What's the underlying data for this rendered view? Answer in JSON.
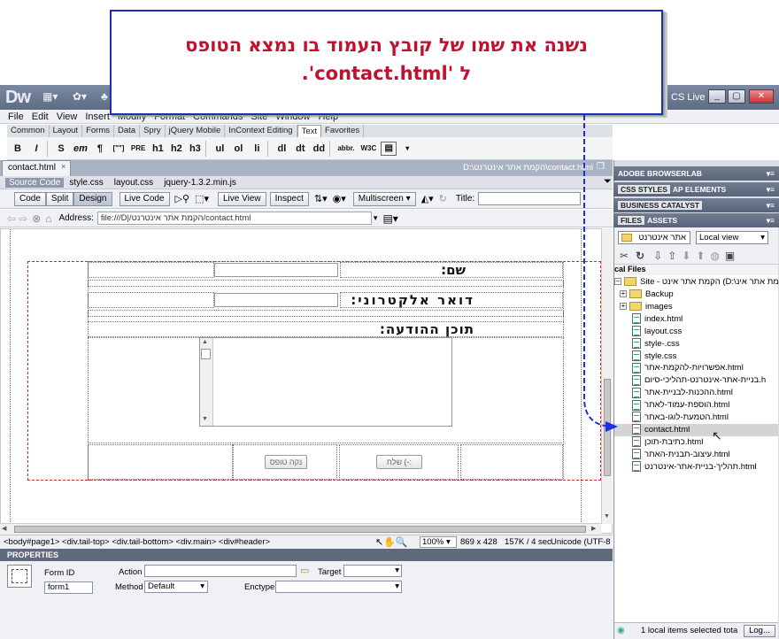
{
  "app": {
    "logo": "Dw",
    "cs_live": "CS Live",
    "window_buttons": [
      "_",
      "▢",
      "✕"
    ]
  },
  "menu": [
    "File",
    "Edit",
    "View",
    "Insert",
    "Modify",
    "Format",
    "Commands",
    "Site",
    "Window",
    "Help"
  ],
  "insert_tabs": [
    "Common",
    "Layout",
    "Forms",
    "Data",
    "Spry",
    "jQuery Mobile",
    "InContext Editing",
    "Text",
    "Favorites"
  ],
  "active_insert_tab": "Text",
  "text_tools": [
    "B",
    "I",
    "S",
    "em",
    "¶",
    "[\"\"]",
    "PRE",
    "h1",
    "h2",
    "h3",
    "ul",
    "ol",
    "li",
    "dl",
    "dt",
    "dd",
    "abbr.",
    "W3C"
  ],
  "document": {
    "tab_name": "contact.html",
    "path": "D:\\הקמת אתר אינטרנט\\contact.html",
    "source_code": "Source Code",
    "related_files": [
      "style.css",
      "layout.css",
      "jquery-1.3.2.min.js"
    ],
    "view_buttons": [
      "Code",
      "Split",
      "Design"
    ],
    "live_code": "Live Code",
    "live_view": "Live View",
    "inspect": "Inspect",
    "multiscreen": "Multiscreen",
    "title_label": "Title:",
    "address_label": "Address:",
    "address_value": "file:///D|/הקמת אתר אינטרנט/contact.html"
  },
  "form": {
    "name_label": "שם:",
    "email_label": "דואר אלקטרוני:",
    "message_label": "תוכן ההודעה:",
    "send_button": "שלח (-:",
    "clear_button": "נקה טופס"
  },
  "status_bar": {
    "tag_path": "<body#page1> <div.tail-top> <div.tail-bottom> <div.main> <div#header>",
    "zoom": "100%",
    "dimensions": "869 x 428",
    "size_time": "157K / 4 sec",
    "encoding": "Unicode (UTF-8"
  },
  "properties": {
    "header": "PROPERTIES",
    "form_id_label": "Form ID",
    "form_id_value": "form1",
    "action_label": "Action",
    "target_label": "Target",
    "method_label": "Method",
    "method_value": "Default",
    "enctype_label": "Enctype"
  },
  "panels": {
    "browserlab": "ADOBE BROWSERLAB",
    "css_styles": "CSS STYLES",
    "ap_elements": "AP ELEMENTS",
    "business_catalyst": "BUSINESS CATALYST",
    "files_tab": "FILES",
    "assets_tab": "ASSETS",
    "site_select": "אתר אינטרנט",
    "view_select": "Local view",
    "local_files": "cal Files",
    "site_root": "Site - הקמת אתר אינט (D:\\הקמת אתר אינ",
    "items": [
      {
        "name": "Backup",
        "type": "folder"
      },
      {
        "name": "images",
        "type": "folder"
      },
      {
        "name": "index.html",
        "type": "file"
      },
      {
        "name": "layout.css",
        "type": "file"
      },
      {
        "name": "style-.css",
        "type": "file"
      },
      {
        "name": "style.css",
        "type": "file"
      },
      {
        "name": "אפשרויות-להקמת-אתר.html",
        "type": "file"
      },
      {
        "name": "בניית-אתר-אינטרנט-תהליכי-סיום.h",
        "type": "file"
      },
      {
        "name": "ההכנות-לבניית-אתר.html",
        "type": "file"
      },
      {
        "name": "הוספת-עמוד-לאתר.html",
        "type": "file"
      },
      {
        "name": "הטמעת-לוגו-באתר.html",
        "type": "file"
      },
      {
        "name": "contact.html",
        "type": "file",
        "selected": true
      },
      {
        "name": "כתיבת-תוכן.html",
        "type": "file"
      },
      {
        "name": "עיצוב-תבנית-האתר.html",
        "type": "file"
      },
      {
        "name": "תהליך-בניית-אתר-אינטרנט.html",
        "type": "file"
      }
    ],
    "files_status": "1 local items selected tota",
    "log_button": "Log..."
  },
  "callout": {
    "line1": "נשנה את שמו של קובץ העמוד בו נמצא הטופס",
    "line2": "ל 'contact.html'."
  },
  "colors": {
    "callout_border": "#1a2fb8",
    "callout_text": "#c2102f",
    "arrow": "#1a2fe0",
    "form_outline": "#e02020"
  }
}
